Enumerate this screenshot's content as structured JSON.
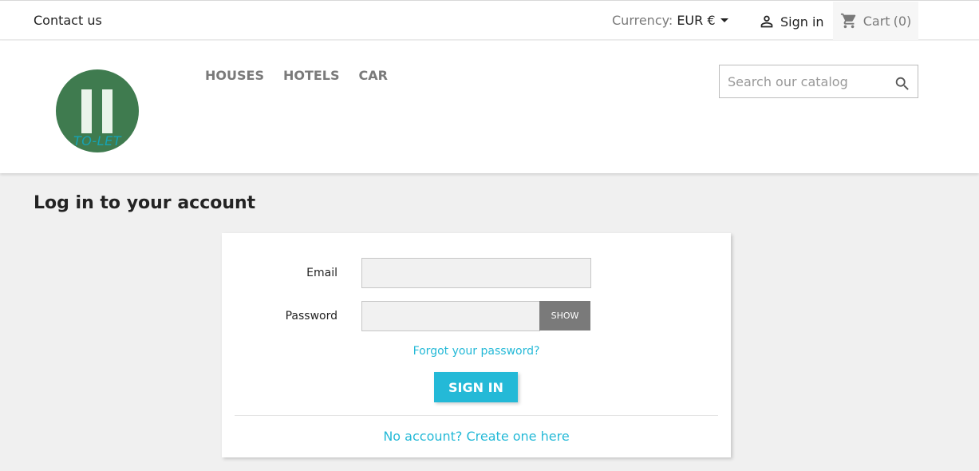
{
  "topbar": {
    "contact_label": "Contact us",
    "currency_label": "Currency:",
    "currency_value": "EUR €",
    "signin_label": "Sign in",
    "cart_label": "Cart",
    "cart_count": "(0)"
  },
  "header": {
    "logo_text": "TO-LET",
    "nav": [
      "HOUSES",
      "HOTELS",
      "CAR"
    ],
    "search_placeholder": "Search our catalog"
  },
  "login": {
    "title": "Log in to your account",
    "email_label": "Email",
    "email_value": "",
    "password_label": "Password",
    "password_value": "",
    "show_label": "SHOW",
    "forgot_label": "Forgot your password?",
    "signin_button": "SIGN IN",
    "create_account_label": "No account? Create one here"
  },
  "colors": {
    "accent": "#24b9d7",
    "logo_green": "#3f7b4f",
    "background": "#f0f0f0"
  }
}
